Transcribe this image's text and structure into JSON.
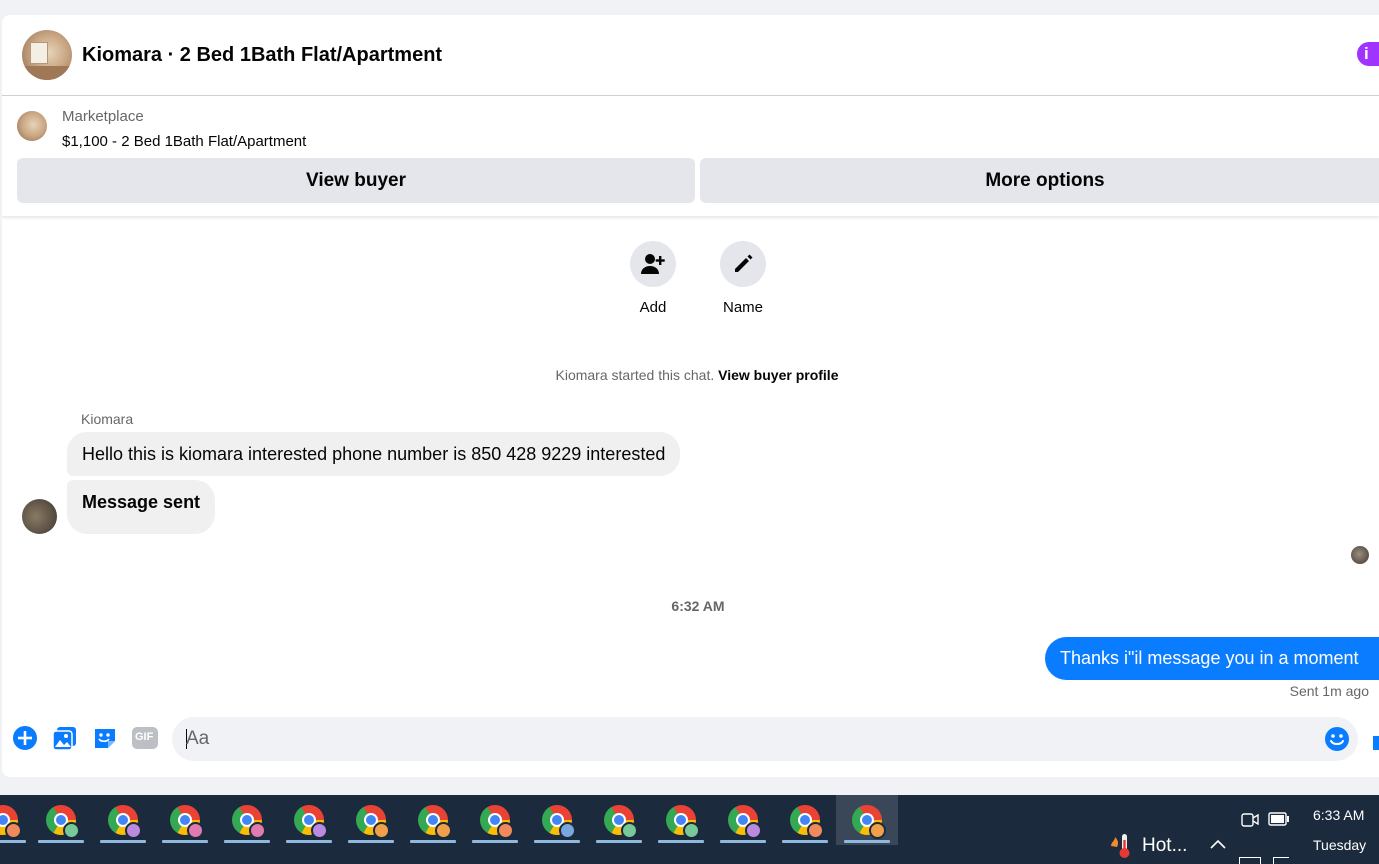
{
  "header": {
    "title": "Kiomara · 2 Bed 1Bath Flat/Apartment",
    "info_icon": "i"
  },
  "listing": {
    "label": "Marketplace",
    "price_title": "$1,100 - 2 Bed 1Bath Flat/Apartment",
    "view_buyer_label": "View buyer",
    "more_options_label": "More options"
  },
  "actions": [
    {
      "label": "Add",
      "icon": "add-person-icon"
    },
    {
      "label": "Name",
      "icon": "pencil-icon"
    }
  ],
  "chat": {
    "started_text": "Kiomara started this chat.",
    "started_link": "View buyer profile",
    "sender_name": "Kiomara",
    "incoming": [
      "Hello this is kiomara interested phone number is 850 428 9229 interested",
      "Message sent"
    ],
    "time_divider": "6:32 AM",
    "outgoing": "Thanks i\"il message you in a moment",
    "sent_status": "Sent 1m ago"
  },
  "composer": {
    "placeholder": "Aa",
    "gif_label": "GIF"
  },
  "taskbar": {
    "profile_colors": [
      "#f08a5d",
      "#79c89a",
      "#b98ae0",
      "#e07ab0",
      "#e07ab0",
      "#b98ae0",
      "#f0a04b",
      "#f0a04b",
      "#f08a5d",
      "#7aa6e0",
      "#79c89a",
      "#79c89a",
      "#b98ae0",
      "#f08a5d",
      "#f0a04b"
    ],
    "weather_text": "Hot...",
    "time": "6:33 AM",
    "day": "Tuesday"
  },
  "colors": {
    "accent_blue": "#0a7cff",
    "info_purple": "#a033ff",
    "taskbar_bg": "#1b2a3c"
  }
}
